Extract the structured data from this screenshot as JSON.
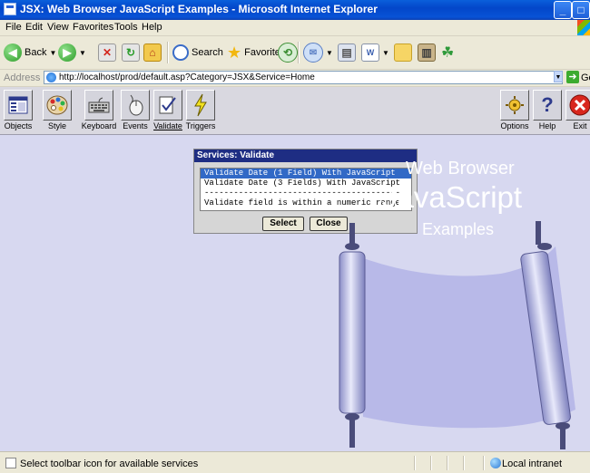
{
  "window": {
    "title": "JSX: Web Browser JavaScript Examples - Microsoft Internet Explorer"
  },
  "menu": [
    "File",
    "Edit",
    "View",
    "Favorites",
    "Tools",
    "Help"
  ],
  "std_toolbar": {
    "back": "Back",
    "search": "Search",
    "favorites": "Favorites"
  },
  "address": {
    "label": "Address",
    "url": "http://localhost/prod/default.asp?Category=JSX&Service=Home",
    "go": "Go"
  },
  "app_toolbar": {
    "left": [
      "Objects",
      "Style",
      "Keyboard",
      "Events",
      "Validate",
      "Triggers"
    ],
    "right": [
      "Options",
      "Help",
      "Exit"
    ],
    "active": "Validate"
  },
  "dialog": {
    "title": "Services: Validate",
    "items": [
      "Validate Date (1 Field) With JavaScript",
      "Validate Date (3 Fields) With JavaScript",
      "----------------------------------------",
      "Validate field is within a numeric range"
    ],
    "selected_index": 0,
    "select_label": "Select",
    "close_label": "Close"
  },
  "artwork": {
    "line1": "Web Browser",
    "line2": "JavaScript",
    "line3": "Examples"
  },
  "status": {
    "text": "Select toolbar icon for available services",
    "zone": "Local intranet"
  },
  "colors": {
    "page_bg": "#d7d8f0",
    "dialog_title_bg": "#1e2d83",
    "selection": "#3169c6"
  }
}
